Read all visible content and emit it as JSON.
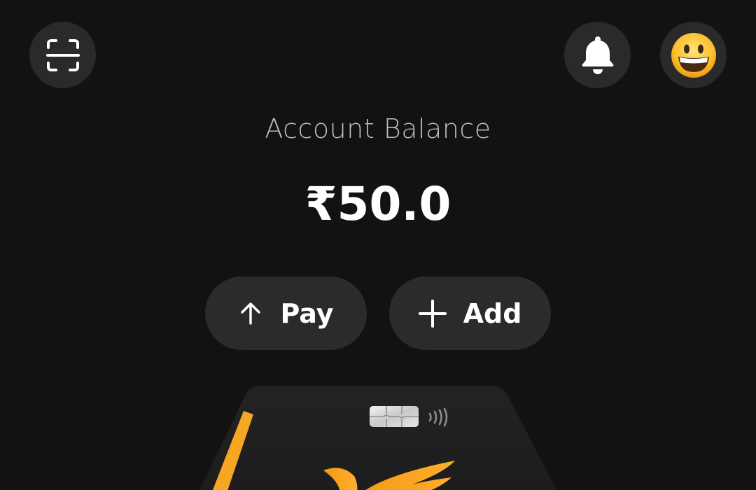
{
  "header": {
    "scan_icon": "scan-qr-icon",
    "bell_icon": "bell-icon",
    "avatar_icon": "grinning-face-emoji"
  },
  "balance": {
    "label": "Account Balance",
    "amount": "₹50.0"
  },
  "actions": {
    "pay_label": "Pay",
    "pay_icon": "arrow-up-icon",
    "add_label": "Add",
    "add_icon": "plus-icon"
  },
  "card": {
    "chip_icon": "card-chip-icon",
    "contactless_icon": "contactless-icon",
    "logo_icon": "bird-logo-icon"
  },
  "colors": {
    "background": "#121212",
    "button_bg": "#2a2a2a",
    "accent": "#f5a623",
    "text_primary": "#ffffff",
    "text_secondary": "#bdbdbd"
  }
}
